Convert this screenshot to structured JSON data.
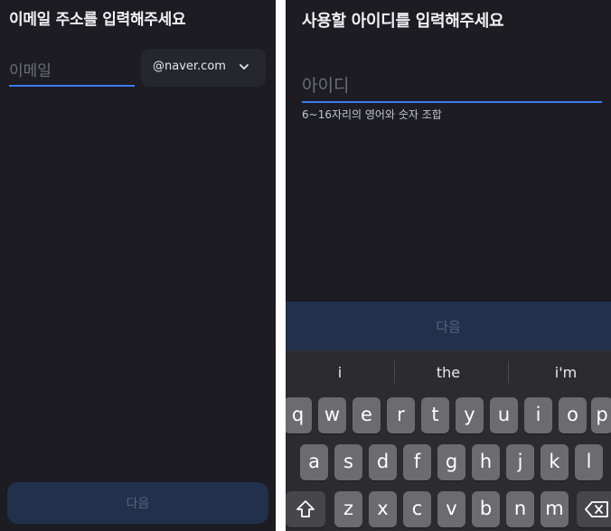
{
  "left_screen": {
    "title": "이메일 주소를 입력해주세요",
    "email_placeholder": "이메일",
    "domain_value": "@naver.com",
    "next_label": "다음"
  },
  "right_screen": {
    "title": "사용할 아이디를 입력해주세요",
    "id_placeholder": "아이디",
    "id_hint": "6~16자리의 영어와 숫자 조합",
    "next_label": "다음"
  },
  "keyboard": {
    "suggestions": [
      "i",
      "the",
      "i'm"
    ],
    "row1": [
      "q",
      "w",
      "e",
      "r",
      "t",
      "y",
      "u",
      "i",
      "o",
      "p"
    ],
    "row2": [
      "a",
      "s",
      "d",
      "f",
      "g",
      "h",
      "j",
      "k",
      "l"
    ],
    "row3": [
      "z",
      "x",
      "c",
      "v",
      "b",
      "n",
      "m"
    ]
  },
  "colors": {
    "background": "#1c1c22",
    "accent": "#3d7bf0",
    "disabled_button": "#22314b",
    "key": "#6b6b70"
  }
}
